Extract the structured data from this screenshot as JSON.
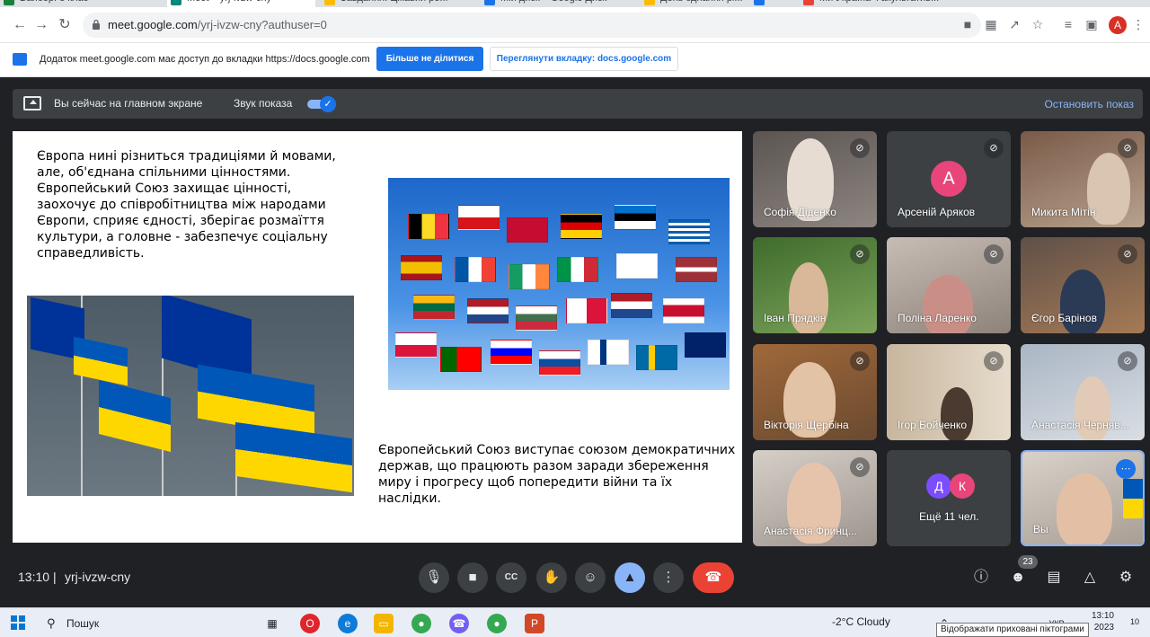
{
  "browser": {
    "tabs": [
      {
        "label": "Вайбер: 8 клас",
        "color": "#188038"
      },
      {
        "label": "Meet – yrj-ivzw-cny",
        "color": "#00897b",
        "active": true
      },
      {
        "label": "Завдання: Цікавий ре...",
        "color": "#fbbc04"
      },
      {
        "label": "Мій диск – Google Диск",
        "color": "#1a73e8"
      },
      {
        "label": "День єднання рі...",
        "color": "#fbbc04"
      },
      {
        "label": "",
        "color": "#1a73e8"
      },
      {
        "label": "Ми Україна Факультатив...",
        "color": "#ea4335"
      }
    ],
    "url_host": "meet.google.com",
    "url_path": "/yrj-ivzw-cny?authuser=0",
    "profile_initial": "A"
  },
  "sharebar": {
    "message": "Додаток meet.google.com має доступ до вкладки https://docs.google.com",
    "stop_sharing_label": "Більше не ділитися",
    "view_tab_label": "Переглянути вкладку: docs.google.com"
  },
  "presentbar": {
    "status": "Вы сейчас на главном экране",
    "audio_label": "Звук показа",
    "stop_label": "Остановить показ"
  },
  "slide": {
    "text1": "Європа нині різниться традиціями й мовами, але, об'єднана спільними цінностями. Європейський Союз захищає цінності, заохочує до співробітництва між народами Європи, сприяє єдності, зберігає розмаїття культури, а головне - забезпечує соціальну справедливість.",
    "text2": "Європейський Союз виступає союзом демократичних держав, що працюють разом заради збереження миру і прогресу щоб попередити війни та їх наслідки."
  },
  "participants": [
    {
      "name": "Софія Діденко",
      "bg": "#6e6a68"
    },
    {
      "name": "Арсеній Аряков",
      "avatar": "A",
      "avatar_color": "#e8457a"
    },
    {
      "name": "Микита Мітін",
      "bg": "#8a6d5a"
    },
    {
      "name": "Іван Прядкін",
      "bg": "#4f7d3a"
    },
    {
      "name": "Поліна Ларенко",
      "bg": "#a89a92"
    },
    {
      "name": "Єгор Барінов",
      "bg": "#7a6a5e"
    },
    {
      "name": "Вікторія Щербіна",
      "bg": "#8b5e3c"
    },
    {
      "name": "Ігор Бойченко",
      "bg": "#b9a58f"
    },
    {
      "name": "Анастасія Черняв...",
      "bg": "#9aa7b5"
    },
    {
      "name": "Анастасія Фринц...",
      "bg": "#b7b0a8"
    },
    {
      "name": "Ещё 11 чел.",
      "avatars": [
        "Д",
        "К"
      ],
      "avatar_colors": [
        "#7c4dff",
        "#e8457a"
      ]
    },
    {
      "name": "Вы",
      "bg": "#b7a99c",
      "active": true
    }
  ],
  "meeting": {
    "time": "13:10",
    "separator": "|",
    "code": "yrj-ivzw-cny",
    "people_count": "23"
  },
  "taskbar": {
    "search_label": "Пошук",
    "weather": "-2°C  Cloudy",
    "clock_time": "13:10",
    "clock_date": "2023",
    "tray_lang": "УКР",
    "notifications": "10",
    "tooltip": "Відображати приховані піктограми"
  }
}
